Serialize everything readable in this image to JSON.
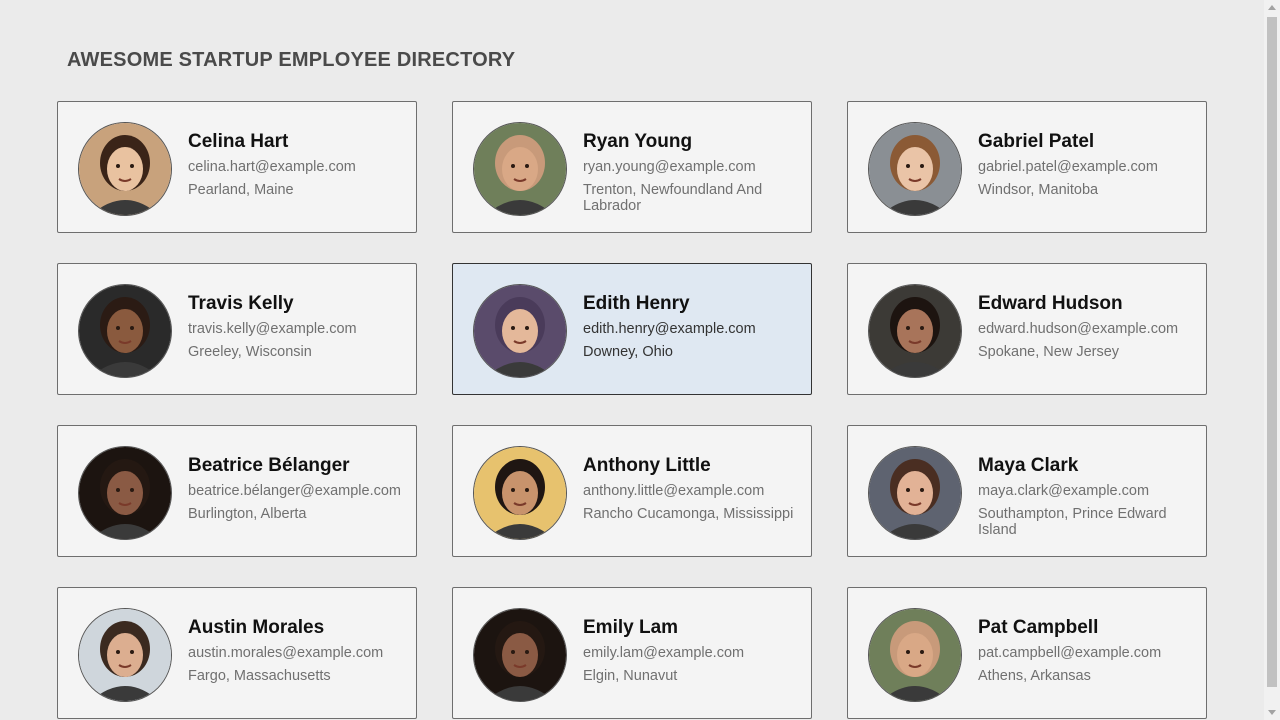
{
  "header": {
    "title": "AWESOME STARTUP EMPLOYEE DIRECTORY"
  },
  "employees": [
    {
      "name": "Celina Hart",
      "email": "celina.hart@example.com",
      "location": "Pearland, Maine",
      "avatar_bg": "#c8a27c",
      "avatar_skin": "#e9c2a0",
      "avatar_hair": "#3a2418"
    },
    {
      "name": "Ryan Young",
      "email": "ryan.young@example.com",
      "location": "Trenton, Newfoundland And Labrador",
      "avatar_bg": "#6f7f5a",
      "avatar_skin": "#d9a886",
      "avatar_hair": "#c89a7a"
    },
    {
      "name": "Gabriel Patel",
      "email": "gabriel.patel@example.com",
      "location": "Windsor, Manitoba",
      "avatar_bg": "#8a8f94",
      "avatar_skin": "#eac4a7",
      "avatar_hair": "#8b5a35"
    },
    {
      "name": "Travis Kelly",
      "email": "travis.kelly@example.com",
      "location": "Greeley, Wisconsin",
      "avatar_bg": "#2a2a2a",
      "avatar_skin": "#8a5a3e",
      "avatar_hair": "#2b1b14"
    },
    {
      "name": "Edith Henry",
      "email": "edith.henry@example.com",
      "location": "Downey, Ohio",
      "avatar_bg": "#5a4b6b",
      "avatar_skin": "#e4b89a",
      "avatar_hair": "#4a3b5a"
    },
    {
      "name": "Edward Hudson",
      "email": "edward.hudson@example.com",
      "location": "Spokane, New Jersey",
      "avatar_bg": "#3c3a36",
      "avatar_skin": "#a8745a",
      "avatar_hair": "#1d1410"
    },
    {
      "name": "Beatrice Bélanger",
      "email": "beatrice.bélanger@example.com",
      "location": "Burlington, Alberta",
      "avatar_bg": "#1c1410",
      "avatar_skin": "#8a5a44",
      "avatar_hair": "#241812"
    },
    {
      "name": "Anthony Little",
      "email": "anthony.little@example.com",
      "location": "Rancho Cucamonga, Mississippi",
      "avatar_bg": "#e7c26e",
      "avatar_skin": "#c8936c",
      "avatar_hair": "#1f1612"
    },
    {
      "name": "Maya Clark",
      "email": "maya.clark@example.com",
      "location": "Southampton, Prince Edward Island",
      "avatar_bg": "#5e6370",
      "avatar_skin": "#e2b296",
      "avatar_hair": "#4a2e22"
    },
    {
      "name": "Austin Morales",
      "email": "austin.morales@example.com",
      "location": "Fargo, Massachusetts",
      "avatar_bg": "#cfd6dc",
      "avatar_skin": "#dcae90",
      "avatar_hair": "#3b2a20"
    },
    {
      "name": "Emily Lam",
      "email": "emily.lam@example.com",
      "location": "Elgin, Nunavut",
      "avatar_bg": "#1c1410",
      "avatar_skin": "#8a5a44",
      "avatar_hair": "#241812"
    },
    {
      "name": "Pat Campbell",
      "email": "pat.campbell@example.com",
      "location": "Athens, Arkansas",
      "avatar_bg": "#6f7f5a",
      "avatar_skin": "#d9a886",
      "avatar_hair": "#c89a7a"
    }
  ],
  "selected_index": 4
}
